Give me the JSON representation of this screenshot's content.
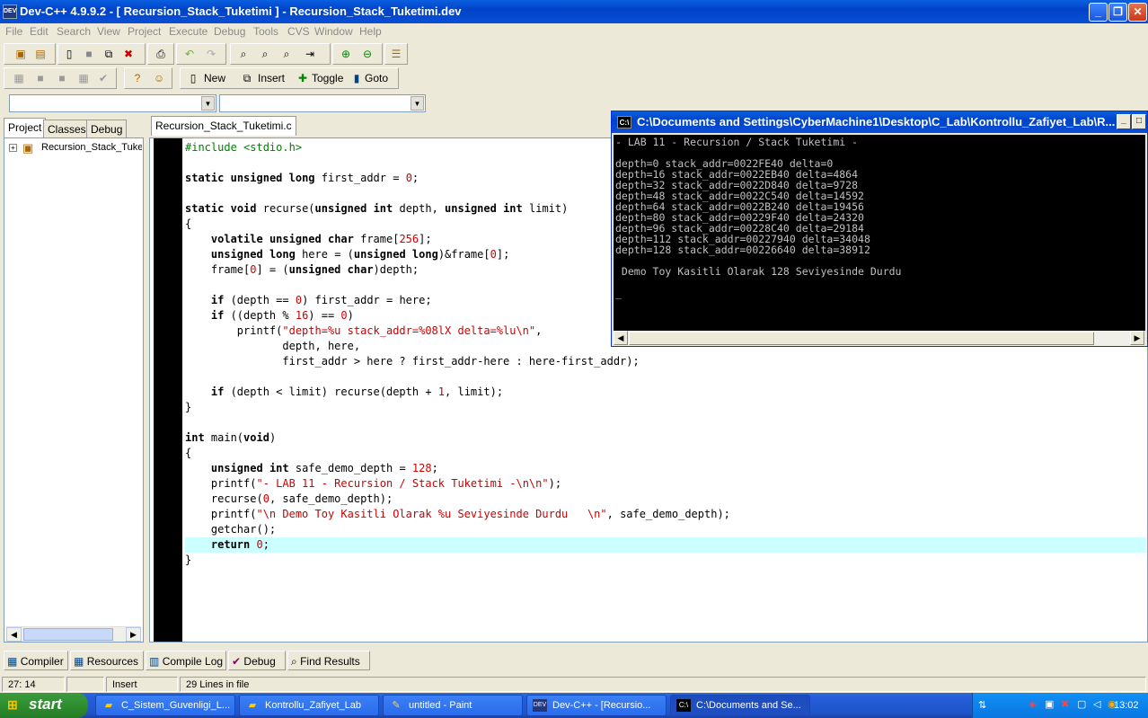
{
  "window": {
    "title": "Dev-C++ 4.9.9.2  -  [ Recursion_Stack_Tuketimi ] - Recursion_Stack_Tuketimi.dev",
    "icon_text": "DEV"
  },
  "menu": [
    "File",
    "Edit",
    "Search",
    "View",
    "Project",
    "Execute",
    "Debug",
    "Tools",
    "CVS",
    "Window",
    "Help"
  ],
  "toolbar2": {
    "new": "New",
    "insert": "Insert",
    "toggle": "Toggle",
    "goto": "Goto"
  },
  "left_tabs": [
    "Project",
    "Classes",
    "Debug"
  ],
  "project_tree": {
    "item": "Recursion_Stack_Tuke"
  },
  "editor": {
    "tab": "Recursion_Stack_Tuketimi.c",
    "lines": [
      "#include <stdio.h>",
      "",
      "static unsigned long first_addr = 0;",
      "",
      "static void recurse(unsigned int depth, unsigned int limit)",
      "{",
      "    volatile unsigned char frame[256];",
      "    unsigned long here = (unsigned long)&frame[0];",
      "    frame[0] = (unsigned char)depth;",
      "",
      "    if (depth == 0) first_addr = here;",
      "    if ((depth % 16) == 0)",
      "        printf(\"depth=%u stack_addr=%08lX delta=%lu\\n\",",
      "               depth, here,",
      "               first_addr > here ? first_addr-here : here-first_addr);",
      "",
      "    if (depth < limit) recurse(depth + 1, limit);",
      "}",
      "",
      "int main(void)",
      "{",
      "    unsigned int safe_demo_depth = 128;",
      "    printf(\"- LAB 11 - Recursion / Stack Tuketimi -\\n\\n\");",
      "    recurse(0, safe_demo_depth);",
      "    printf(\"\\n Demo Toy Kasitli Olarak %u Seviyesinde Durdu   \\n\", safe_demo_depth);",
      "    getchar();",
      "    return 0;",
      "}"
    ],
    "highlight_line": 27
  },
  "console": {
    "title": "C:\\Documents and Settings\\CyberMachine1\\Desktop\\C_Lab\\Kontrollu_Zafiyet_Lab\\R...",
    "icon_text": "C:\\",
    "lines": [
      "- LAB 11 - Recursion / Stack Tuketimi -",
      "",
      "depth=0 stack_addr=0022FE40 delta=0",
      "depth=16 stack_addr=0022EB40 delta=4864",
      "depth=32 stack_addr=0022D840 delta=9728",
      "depth=48 stack_addr=0022C540 delta=14592",
      "depth=64 stack_addr=0022B240 delta=19456",
      "depth=80 stack_addr=00229F40 delta=24320",
      "depth=96 stack_addr=00228C40 delta=29184",
      "depth=112 stack_addr=00227940 delta=34048",
      "depth=128 stack_addr=00226640 delta=38912",
      "",
      " Demo Toy Kasitli Olarak 128 Seviyesinde Durdu",
      "",
      "_"
    ]
  },
  "bottom_tabs": [
    "Compiler",
    "Resources",
    "Compile Log",
    "Debug",
    "Find Results"
  ],
  "status": {
    "position": "27: 14",
    "mode": "Insert",
    "lines": "29 Lines in file"
  },
  "taskbar": {
    "start": "start",
    "tasks": [
      "C_Sistem_Guvenligi_L...",
      "Kontrollu_Zafiyet_Lab",
      "untitled - Paint",
      "Dev-C++ - [Recursio...",
      "C:\\Documents and Se..."
    ],
    "clock": "13:02"
  }
}
